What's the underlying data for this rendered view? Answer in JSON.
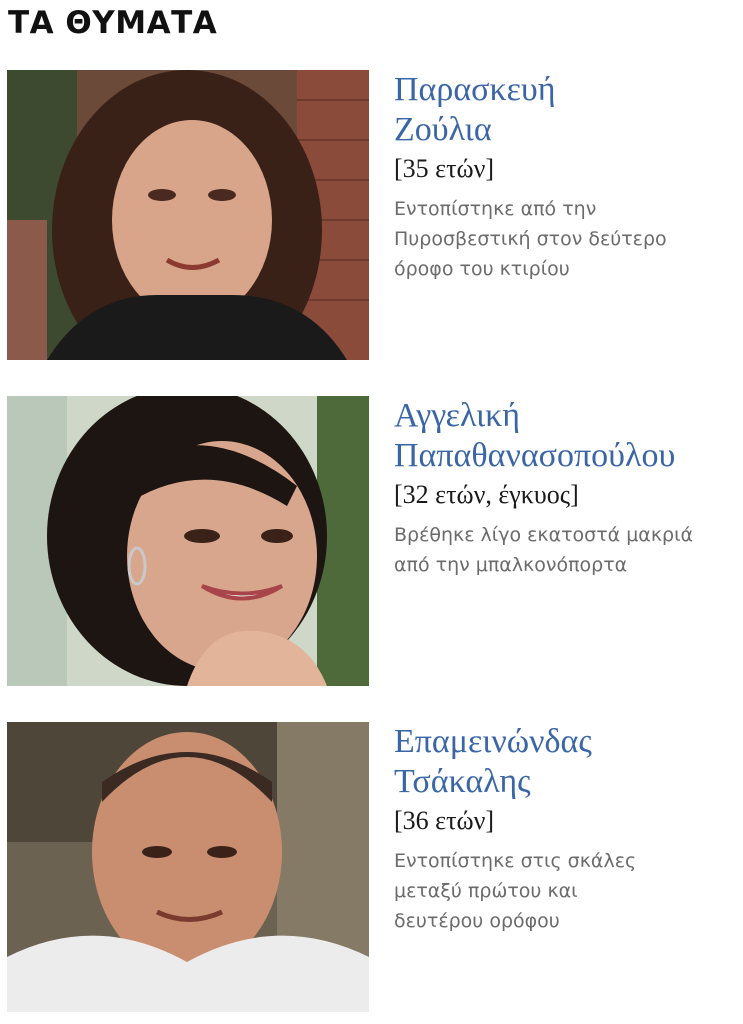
{
  "heading": "ΤΑ ΘΥΜΑΤΑ",
  "victims": [
    {
      "name_line1": "Παρασκευή",
      "name_line2": "Ζούλια",
      "age": "[35 ετών]",
      "desc_line1": "Εντοπίστηκε από την",
      "desc_line2": "Πυροσβεστική στον δεύτερο",
      "desc_line3": "όροφο του κτιρίου"
    },
    {
      "name_line1": "Αγγελική",
      "name_line2": "Παπαθανασοπούλου",
      "age": "[32 ετών, έγκυος]",
      "desc_line1": "Βρέθηκε λίγο εκατοστά μακριά",
      "desc_line2": "από την μπαλκονόπορτα"
    },
    {
      "name_line1": "Επαμεινώνδας",
      "name_line2": "Τσάκαλης",
      "age": "[36 ετών]",
      "desc_line1": "Εντοπίστηκε στις σκάλες",
      "desc_line2": "μεταξύ πρώτου και",
      "desc_line3": "δευτέρου ορόφου"
    }
  ]
}
